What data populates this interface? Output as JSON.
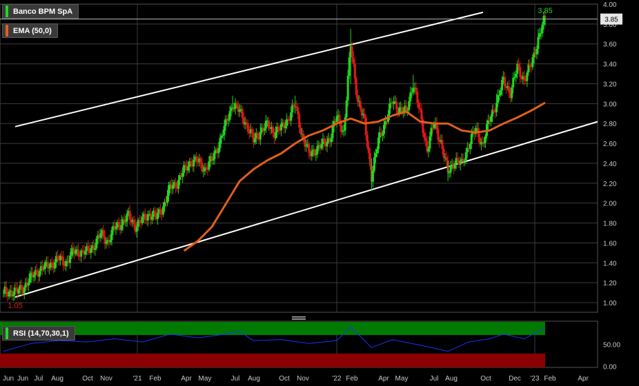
{
  "colors": {
    "up": "#1fd81f",
    "down": "#e01818",
    "ema": "#e0601b",
    "rsi": "#1a33ff",
    "rsi_over": "#007a00",
    "rsi_under": "#8a0000",
    "trendline": "#ffffff",
    "grid": "#3c3c3c",
    "axis_text": "#c8c8c8",
    "background": "#000000"
  },
  "legend": {
    "price": "Banco BPM SpA",
    "ema": "EMA (50,0)",
    "rsi": "RSI (14,70,30,1)"
  },
  "annotations": {
    "high_label": "3.85",
    "low_label": "1.05",
    "last_price": "3.85"
  },
  "chart_data": [
    {
      "type": "candlestick",
      "title": "Banco BPM SpA",
      "ylim": [
        0.9,
        4.0
      ],
      "y_ticks": [
        "1.00",
        "1.20",
        "1.40",
        "1.60",
        "1.80",
        "2.00",
        "2.20",
        "2.40",
        "2.60",
        "2.80",
        "3.00",
        "3.20",
        "3.40",
        "3.60",
        "3.80",
        "4.00"
      ],
      "x_ticks": [
        "Jun",
        "Jun",
        "Jul",
        "Aug",
        "Oct",
        "Nov",
        "'21",
        "Feb",
        "Apr",
        "May",
        "Jul",
        "Aug",
        "Oct",
        "Nov",
        "'22",
        "Feb",
        "Apr",
        "May",
        "Jul",
        "Aug",
        "Oct",
        "Dec",
        "'23",
        "Feb",
        "Apr"
      ],
      "close_path": [
        [
          0,
          1.09
        ],
        [
          5,
          1.12
        ],
        [
          10,
          1.1
        ],
        [
          15,
          1.17
        ],
        [
          20,
          1.25
        ],
        [
          25,
          1.33
        ],
        [
          30,
          1.35
        ],
        [
          35,
          1.4
        ],
        [
          40,
          1.43
        ],
        [
          45,
          1.41
        ],
        [
          50,
          1.5
        ],
        [
          55,
          1.52
        ],
        [
          60,
          1.5
        ],
        [
          65,
          1.58
        ],
        [
          70,
          1.68
        ],
        [
          75,
          1.62
        ],
        [
          80,
          1.74
        ],
        [
          85,
          1.81
        ],
        [
          90,
          1.86
        ],
        [
          95,
          1.78
        ],
        [
          100,
          1.82
        ],
        [
          105,
          1.9
        ],
        [
          110,
          1.85
        ],
        [
          115,
          1.97
        ],
        [
          120,
          2.15
        ],
        [
          125,
          2.21
        ],
        [
          130,
          2.32
        ],
        [
          135,
          2.43
        ],
        [
          140,
          2.41
        ],
        [
          145,
          2.35
        ],
        [
          150,
          2.42
        ],
        [
          155,
          2.6
        ],
        [
          160,
          2.78
        ],
        [
          165,
          3.01
        ],
        [
          170,
          2.91
        ],
        [
          175,
          2.8
        ],
        [
          180,
          2.62
        ],
        [
          185,
          2.73
        ],
        [
          190,
          2.78
        ],
        [
          195,
          2.72
        ],
        [
          200,
          2.74
        ],
        [
          205,
          2.86
        ],
        [
          210,
          2.98
        ],
        [
          215,
          2.69
        ],
        [
          220,
          2.48
        ],
        [
          225,
          2.55
        ],
        [
          230,
          2.58
        ],
        [
          235,
          2.66
        ],
        [
          240,
          2.86
        ],
        [
          245,
          2.72
        ],
        [
          250,
          3.58
        ],
        [
          255,
          3.05
        ],
        [
          260,
          2.8
        ],
        [
          265,
          2.28
        ],
        [
          270,
          2.62
        ],
        [
          275,
          2.83
        ],
        [
          280,
          3.01
        ],
        [
          285,
          2.96
        ],
        [
          290,
          2.9
        ],
        [
          295,
          3.22
        ],
        [
          300,
          2.88
        ],
        [
          305,
          2.55
        ],
        [
          310,
          2.8
        ],
        [
          315,
          2.62
        ],
        [
          320,
          2.3
        ],
        [
          325,
          2.44
        ],
        [
          330,
          2.38
        ],
        [
          335,
          2.6
        ],
        [
          340,
          2.73
        ],
        [
          345,
          2.6
        ],
        [
          350,
          2.83
        ],
        [
          355,
          3.02
        ],
        [
          360,
          3.22
        ],
        [
          365,
          3.12
        ],
        [
          370,
          3.35
        ],
        [
          375,
          3.25
        ],
        [
          380,
          3.38
        ],
        [
          385,
          3.66
        ],
        [
          390,
          3.85
        ]
      ],
      "wicks": [
        [
          0,
          1.05,
          1.13
        ],
        [
          20,
          1.2,
          1.3
        ],
        [
          50,
          1.45,
          1.56
        ],
        [
          85,
          1.76,
          1.88
        ],
        [
          120,
          2.1,
          2.2
        ],
        [
          165,
          2.95,
          3.08
        ],
        [
          185,
          2.62,
          2.8
        ],
        [
          210,
          2.9,
          3.08
        ],
        [
          250,
          3.2,
          3.75
        ],
        [
          265,
          2.13,
          2.45
        ],
        [
          295,
          3.1,
          3.29
        ],
        [
          320,
          2.22,
          2.42
        ],
        [
          355,
          2.92,
          3.1
        ],
        [
          385,
          3.6,
          3.75
        ],
        [
          390,
          3.78,
          3.89
        ]
      ],
      "ema_path": [
        [
          130,
          1.52
        ],
        [
          140,
          1.62
        ],
        [
          150,
          1.76
        ],
        [
          160,
          1.99
        ],
        [
          170,
          2.22
        ],
        [
          180,
          2.34
        ],
        [
          190,
          2.43
        ],
        [
          200,
          2.5
        ],
        [
          210,
          2.6
        ],
        [
          220,
          2.68
        ],
        [
          230,
          2.73
        ],
        [
          240,
          2.8
        ],
        [
          250,
          2.85
        ],
        [
          260,
          2.8
        ],
        [
          270,
          2.82
        ],
        [
          280,
          2.88
        ],
        [
          290,
          2.92
        ],
        [
          300,
          2.82
        ],
        [
          310,
          2.8
        ],
        [
          320,
          2.8
        ],
        [
          330,
          2.73
        ],
        [
          340,
          2.71
        ],
        [
          350,
          2.73
        ],
        [
          360,
          2.8
        ],
        [
          370,
          2.86
        ],
        [
          380,
          2.93
        ],
        [
          390,
          3.01
        ]
      ],
      "channel_upper": [
        [
          0,
          2.74
        ],
        [
          390,
          4.07
        ]
      ],
      "channel_lower": [
        [
          0,
          1.02
        ],
        [
          390,
          2.66
        ]
      ]
    },
    {
      "type": "line",
      "title": "RSI (14,70,30,1)",
      "ylim": [
        0,
        100
      ],
      "y_ticks": [
        "50.00",
        "0.00"
      ],
      "overbought": 70,
      "oversold": 30,
      "rsi_path": [
        [
          0,
          35
        ],
        [
          20,
          52
        ],
        [
          40,
          58
        ],
        [
          60,
          55
        ],
        [
          80,
          62
        ],
        [
          100,
          55
        ],
        [
          120,
          72
        ],
        [
          140,
          64
        ],
        [
          160,
          72
        ],
        [
          170,
          78
        ],
        [
          180,
          58
        ],
        [
          200,
          60
        ],
        [
          220,
          52
        ],
        [
          240,
          58
        ],
        [
          250,
          88
        ],
        [
          265,
          43
        ],
        [
          280,
          60
        ],
        [
          300,
          48
        ],
        [
          320,
          35
        ],
        [
          335,
          55
        ],
        [
          350,
          62
        ],
        [
          360,
          72
        ],
        [
          375,
          62
        ],
        [
          385,
          78
        ],
        [
          390,
          85
        ]
      ]
    }
  ]
}
